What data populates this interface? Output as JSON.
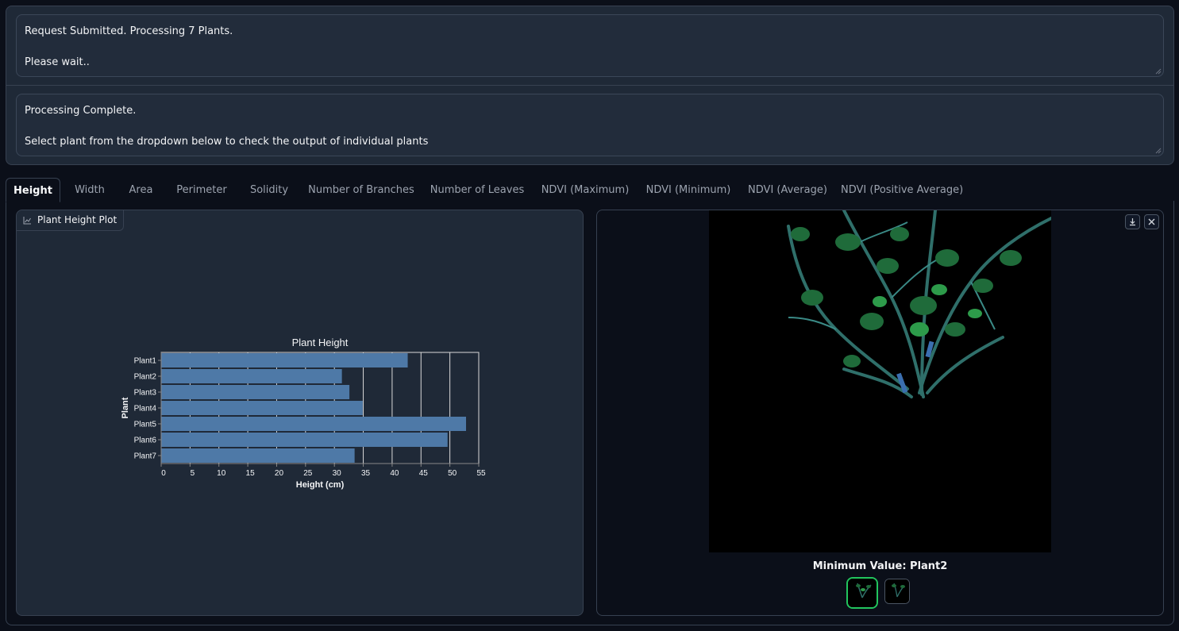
{
  "status_box_1": {
    "lines": [
      "Request Submitted. Processing 7 Plants.",
      "",
      "Please wait.."
    ]
  },
  "status_box_2": {
    "lines": [
      "Processing Complete.",
      "",
      "Select plant from the dropdown below to check the output of individual plants"
    ]
  },
  "tabs": [
    "Height",
    "Width",
    "Area",
    "Perimeter",
    "Solidity",
    "Number of Branches",
    "Number of Leaves",
    "NDVI (Maximum)",
    "NDVI (Minimum)",
    "NDVI (Average)",
    "NDVI (Positive Average)"
  ],
  "active_tab": "Height",
  "plot_panel": {
    "label": "Plant Height Plot",
    "icon": "chart-icon"
  },
  "gallery": {
    "caption": "Minimum Value: Plant2",
    "download_icon": "download-icon",
    "close_icon": "close-icon",
    "thumbnail_count": 2,
    "selected_thumbnail": 1
  },
  "colors": {
    "bar": "#4e79a7",
    "selected_border": "#22c55e",
    "background": "#0b0f19",
    "panel": "#1f2937"
  },
  "chart_data": {
    "type": "bar",
    "orientation": "horizontal",
    "title": "Plant Height",
    "xlabel": "Height (cm)",
    "ylabel": "Plant",
    "categories": [
      "Plant1",
      "Plant2",
      "Plant3",
      "Plant4",
      "Plant5",
      "Plant6",
      "Plant7"
    ],
    "values": [
      42.7,
      31.3,
      32.6,
      34.9,
      52.8,
      49.6,
      33.5
    ],
    "xlim": [
      0,
      55
    ],
    "xticks": [
      "0",
      "5",
      "10",
      "15",
      "20",
      "25",
      "30",
      "35",
      "40",
      "45",
      "50",
      "55"
    ],
    "grid": true
  }
}
